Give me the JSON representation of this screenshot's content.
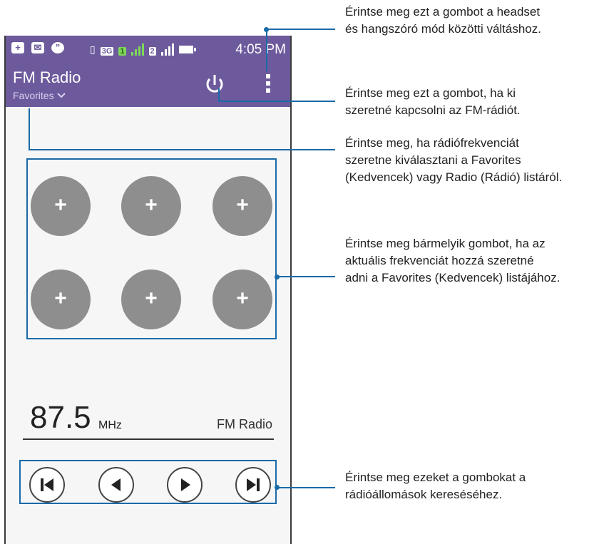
{
  "statusbar": {
    "tag_3g": "3G",
    "tag_sim1": "1",
    "tag_sim2": "2",
    "time": "4:05 PM"
  },
  "appbar": {
    "title": "FM Radio",
    "subtitle": "Favorites",
    "power_icon": "power-icon",
    "menu_icon": "more-vertical-icon"
  },
  "presets": {
    "items": [
      "+",
      "+",
      "+",
      "+",
      "+",
      "+"
    ]
  },
  "tuner": {
    "frequency": "87.5",
    "unit": "MHz",
    "station": "FM Radio"
  },
  "controls": {
    "icons": [
      "skip-previous-icon",
      "seek-back-icon",
      "seek-forward-icon",
      "skip-next-icon"
    ]
  },
  "callouts": {
    "c1_line1": "Érintse meg ezt a gombot a headset",
    "c1_line2": "és hangszóró mód közötti váltáshoz.",
    "c2_line1": "Érintse meg ezt a gombot, ha ki",
    "c2_line2": "szeretné kapcsolni az FM-rádiót.",
    "c3_line1": "Érintse meg, ha rádiófrekvenciát",
    "c3_line2": "szeretne kiválasztani a Favorites",
    "c3_line3": "(Kedvencek) vagy Radio (Rádió) listáról.",
    "c4_line1": "Érintse meg bármelyik gombot, ha az",
    "c4_line2": "aktuális frekvenciát hozzá szeretné",
    "c4_line3": "adni a Favorites (Kedvencek) listájához.",
    "c5_line1": "Érintse meg ezeket a gombokat a",
    "c5_line2": "rádióállomások kereséséhez."
  },
  "colors": {
    "appbar": "#6d5a9c",
    "preset": "#8e8e8e",
    "callout_line": "#1a6aa8"
  }
}
